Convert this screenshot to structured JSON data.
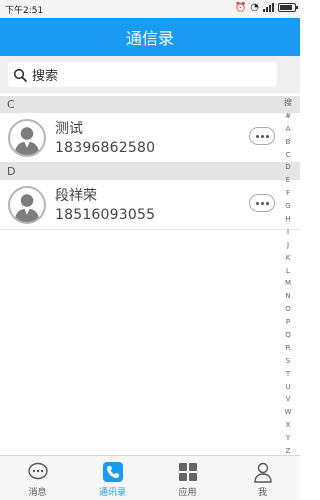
{
  "status_bar": {
    "time": "下午2:51"
  },
  "header": {
    "title": "通信录"
  },
  "search": {
    "placeholder": "搜索"
  },
  "sections": [
    {
      "letter": "C",
      "contacts": [
        {
          "name": "测试",
          "phone": "18396862580"
        }
      ]
    },
    {
      "letter": "D",
      "contacts": [
        {
          "name": "段祥荣",
          "phone": "18516093055"
        }
      ]
    }
  ],
  "index_bar": [
    "搜",
    "#",
    "A",
    "B",
    "C",
    "D",
    "E",
    "F",
    "G",
    "H",
    "I",
    "J",
    "K",
    "L",
    "M",
    "N",
    "O",
    "P",
    "Q",
    "R",
    "S",
    "T",
    "U",
    "V",
    "W",
    "X",
    "Y",
    "Z"
  ],
  "tabs": [
    {
      "label": "消息",
      "icon": "chat-bubble-icon",
      "active": false
    },
    {
      "label": "通讯录",
      "icon": "phone-icon",
      "active": true
    },
    {
      "label": "应用",
      "icon": "grid-icon",
      "active": false
    },
    {
      "label": "我",
      "icon": "person-icon",
      "active": false
    }
  ],
  "colors": {
    "accent": "#1a9af0"
  }
}
